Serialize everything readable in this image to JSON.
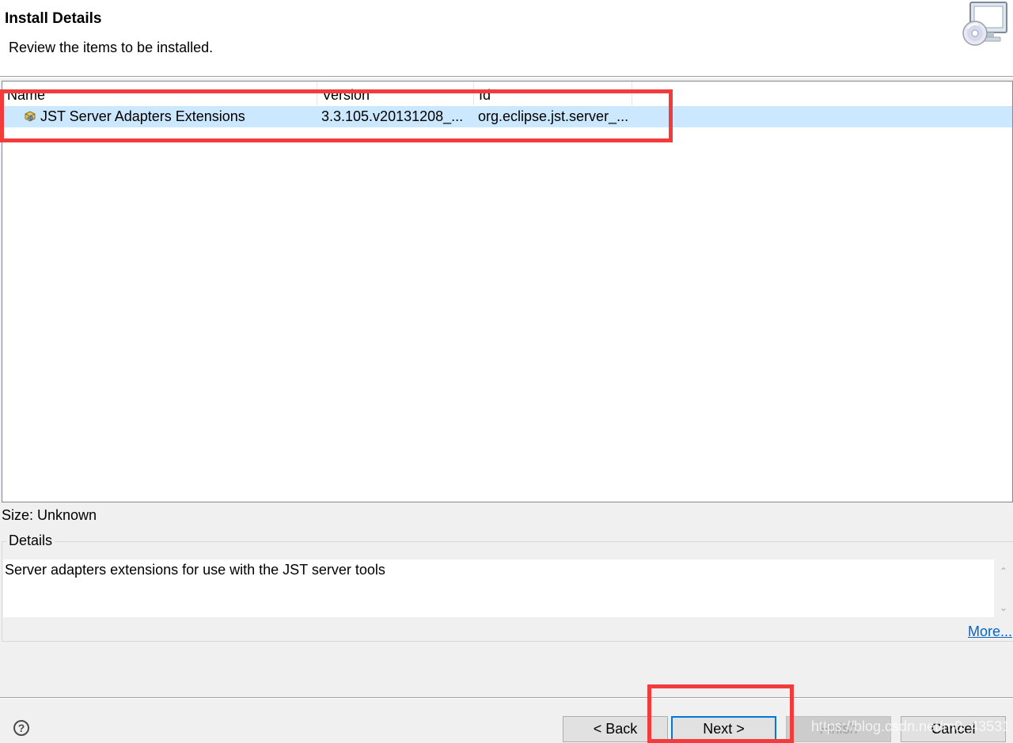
{
  "banner": {
    "title": "Install Details",
    "description": "Review the items to be installed.",
    "icon": "computer-cd-icon"
  },
  "table": {
    "columns": [
      "Name",
      "Version",
      "Id"
    ],
    "rows": [
      {
        "name": "JST Server Adapters Extensions",
        "version": "3.3.105.v20131208_...",
        "id": "org.eclipse.jst.server_...",
        "icon": "installable-unit-icon",
        "selected": true
      }
    ]
  },
  "size": "Size: Unknown",
  "details": {
    "legend": "Details",
    "text": "Server adapters extensions for use with the JST server tools",
    "more_link": "More..."
  },
  "buttons": {
    "back": "< Back",
    "next": "Next >",
    "finish": "Finish",
    "cancel": "Cancel"
  },
  "watermark": "https://blog.csdn.net/m0_43531",
  "colors": {
    "selection": "#cce8ff",
    "highlight": "#f23b3b",
    "link": "#0066cc",
    "default_button_border": "#0078d7"
  }
}
